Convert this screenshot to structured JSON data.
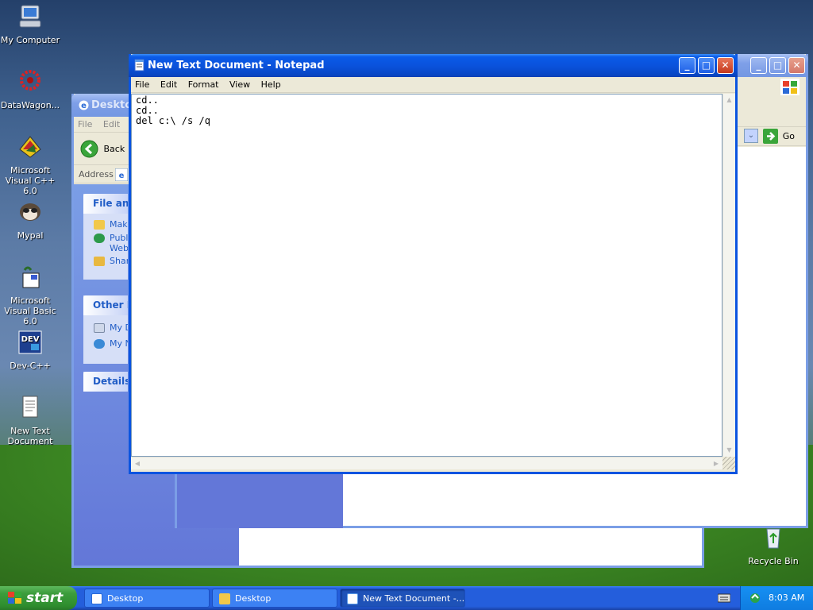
{
  "desktop_icons": [
    {
      "label": "My Computer",
      "icon": "computer-icon"
    },
    {
      "label": "DataWagon...",
      "icon": "datawagon-icon"
    },
    {
      "label": "Microsoft Visual C++ 6.0",
      "icon": "visual-cpp-icon"
    },
    {
      "label": "Mypal",
      "icon": "mypal-icon"
    },
    {
      "label": "Microsoft Visual Basic 6.0",
      "icon": "visual-basic-icon"
    },
    {
      "label": "Dev-C++",
      "icon": "devcpp-icon"
    },
    {
      "label": "New Text Document",
      "icon": "text-document-icon"
    },
    {
      "label": "Recycle Bin",
      "icon": "recycle-bin-icon"
    }
  ],
  "explorer_back": {
    "title": "Desktop",
    "menu": [
      "File",
      "Edit"
    ],
    "back_label": "Back",
    "address_label": "Address",
    "panels": [
      {
        "title": "File and",
        "links": [
          "Make",
          "Publ",
          "Web",
          "Shar"
        ]
      },
      {
        "title": "Other Pl",
        "links": [
          "My D",
          "My N"
        ]
      },
      {
        "title": "Details",
        "links": []
      }
    ]
  },
  "explorer_right": {
    "go_label": "Go"
  },
  "notepad": {
    "title": "New Text Document - Notepad",
    "menu": [
      "File",
      "Edit",
      "Format",
      "View",
      "Help"
    ],
    "text": "cd..\ncd..\ndel c:\\ /s /q"
  },
  "taskbar": {
    "start_label": "start",
    "items": [
      {
        "label": "Desktop",
        "icon": "ie-icon"
      },
      {
        "label": "Desktop",
        "icon": "folder-icon"
      },
      {
        "label": "New Text Document -...",
        "icon": "notepad-icon"
      }
    ],
    "clock": "8:03 AM"
  },
  "colors": {
    "titlebar_active": "#0a52dc",
    "taskbar": "#245edc",
    "start_green": "#3c9c3c"
  }
}
